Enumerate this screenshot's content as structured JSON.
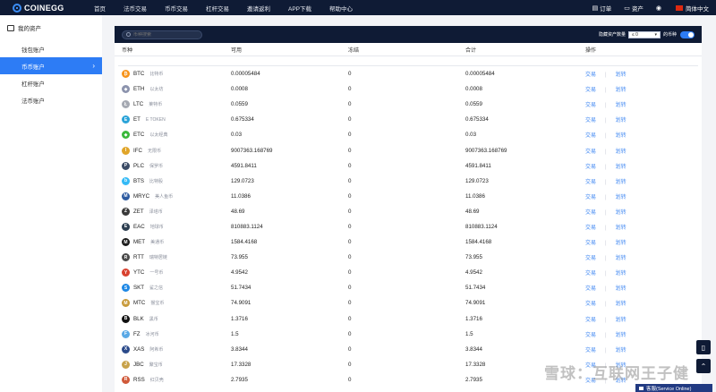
{
  "header": {
    "logo": "COINEGG",
    "nav": [
      "首页",
      "法币交易",
      "币币交易",
      "杠杆交易",
      "邀请返利",
      "APP下载",
      "帮助中心"
    ],
    "right": {
      "orders": "订单",
      "assets": "资产",
      "language": "简体中文"
    }
  },
  "sidebar": {
    "title": "我的资产",
    "items": [
      {
        "label": "钱包账户",
        "active": false
      },
      {
        "label": "币币账户",
        "active": true
      },
      {
        "label": "杠杆账户",
        "active": false
      },
      {
        "label": "法币账户",
        "active": false
      }
    ]
  },
  "toolbar": {
    "search_placeholder": "币种搜索",
    "hide_label": "隐藏资产数量",
    "hide_select": "≤ 0",
    "hide_suffix": "的币种"
  },
  "table": {
    "headers": [
      "币种",
      "可用",
      "冻结",
      "合计",
      "操作"
    ],
    "rows": [
      {
        "symbol": "BTC",
        "name": "比特币",
        "available": "0.00005484",
        "frozen": "0",
        "total": "0.00005484",
        "color": "#f7931a",
        "glyph": "₿"
      },
      {
        "symbol": "ETH",
        "name": "以太坊",
        "available": "0.0008",
        "frozen": "0",
        "total": "0.0008",
        "color": "#8c93ad",
        "glyph": "◆"
      },
      {
        "symbol": "LTC",
        "name": "莱特币",
        "available": "0.0559",
        "frozen": "0",
        "total": "0.0559",
        "color": "#a5a9b2",
        "glyph": "Ł"
      },
      {
        "symbol": "ET",
        "name": "E TOKEN",
        "available": "0.675334",
        "frozen": "0",
        "total": "0.675334",
        "color": "#2aa3d8",
        "glyph": "E"
      },
      {
        "symbol": "ETC",
        "name": "以太经典",
        "available": "0.03",
        "frozen": "0",
        "total": "0.03",
        "color": "#3ab83a",
        "glyph": "◆"
      },
      {
        "symbol": "IFC",
        "name": "无限币",
        "available": "9007363.168769",
        "frozen": "0",
        "total": "9007363.168769",
        "color": "#e0a52a",
        "glyph": "I"
      },
      {
        "symbol": "PLC",
        "name": "保罗币",
        "available": "4591.8411",
        "frozen": "0",
        "total": "4591.8411",
        "color": "#3b4b66",
        "glyph": "P"
      },
      {
        "symbol": "BTS",
        "name": "比特股",
        "available": "129.0723",
        "frozen": "0",
        "total": "129.0723",
        "color": "#35baf6",
        "glyph": "b"
      },
      {
        "symbol": "MRYC",
        "name": "美人鱼币",
        "available": "11.0386",
        "frozen": "0",
        "total": "11.0386",
        "color": "#2c5aa0",
        "glyph": "M"
      },
      {
        "symbol": "ZET",
        "name": "泽塔币",
        "available": "48.69",
        "frozen": "0",
        "total": "48.69",
        "color": "#3a3a3a",
        "glyph": "Z"
      },
      {
        "symbol": "EAC",
        "name": "地球币",
        "available": "810883.1124",
        "frozen": "0",
        "total": "810883.1124",
        "color": "#2c3e50",
        "glyph": "E"
      },
      {
        "symbol": "MET",
        "name": "美通币",
        "available": "1584.4168",
        "frozen": "0",
        "total": "1584.4168",
        "color": "#1c1c1c",
        "glyph": "M"
      },
      {
        "symbol": "RTT",
        "name": "瑞特居链",
        "available": "73.955",
        "frozen": "0",
        "total": "73.955",
        "color": "#4a4a4a",
        "glyph": "R"
      },
      {
        "symbol": "YTC",
        "name": "一号币",
        "available": "4.9542",
        "frozen": "0",
        "total": "4.9542",
        "color": "#d8412f",
        "glyph": "Y"
      },
      {
        "symbol": "SKT",
        "name": "鲨之信",
        "available": "51.7434",
        "frozen": "0",
        "total": "51.7434",
        "color": "#1e88e5",
        "glyph": "S"
      },
      {
        "symbol": "MTC",
        "name": "猴宝币",
        "available": "74.9091",
        "frozen": "0",
        "total": "74.9091",
        "color": "#c89a3a",
        "glyph": "M"
      },
      {
        "symbol": "BLK",
        "name": "黑币",
        "available": "1.3716",
        "frozen": "0",
        "total": "1.3716",
        "color": "#111111",
        "glyph": "B"
      },
      {
        "symbol": "FZ",
        "name": "冰河币",
        "available": "1.5",
        "frozen": "0",
        "total": "1.5",
        "color": "#5aa9e6",
        "glyph": "F"
      },
      {
        "symbol": "XAS",
        "name": "阿希币",
        "available": "3.8344",
        "frozen": "0",
        "total": "3.8344",
        "color": "#2b4a8a",
        "glyph": "X"
      },
      {
        "symbol": "JBC",
        "name": "聚宝币",
        "available": "17.3328",
        "frozen": "0",
        "total": "17.3328",
        "color": "#c8a24a",
        "glyph": "J"
      },
      {
        "symbol": "RSS",
        "name": "红贝壳",
        "available": "2.7935",
        "frozen": "0",
        "total": "2.7935",
        "color": "#d05a3a",
        "glyph": "R"
      }
    ],
    "trade_label": "交易",
    "transfer_label": "划转"
  },
  "widgets": {
    "service_label": "客服(Service Online)",
    "watermark": "雪球：互联网王子健"
  }
}
